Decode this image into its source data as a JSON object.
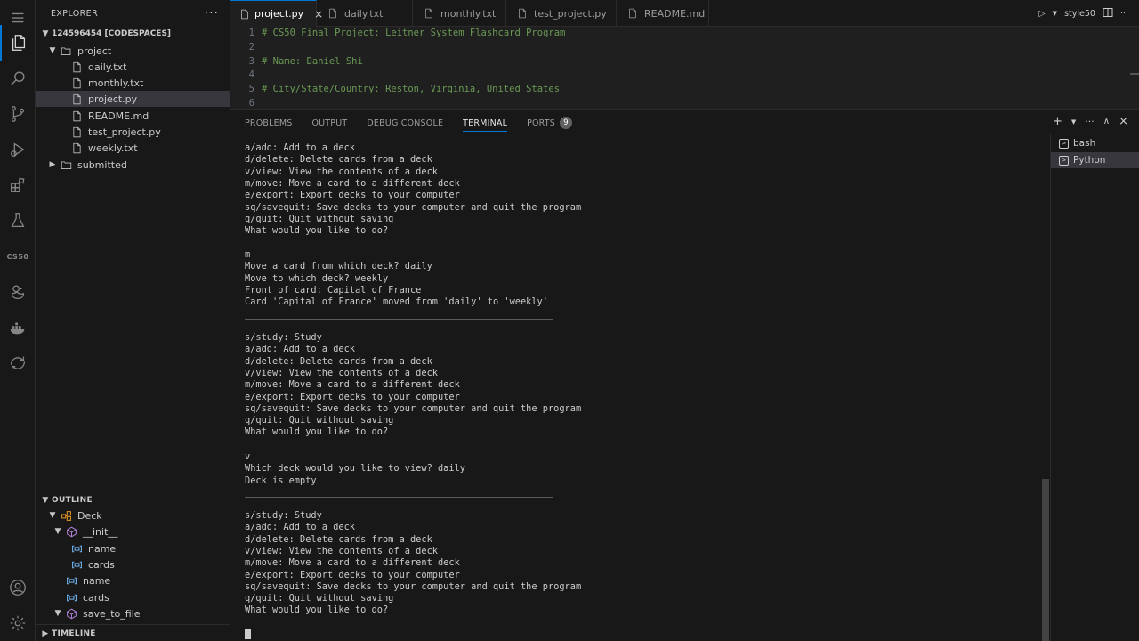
{
  "sidebar": {
    "title": "EXPLORER",
    "root": "124596454 [CODESPACES]",
    "items": [
      {
        "label": "project",
        "kind": "folder-open"
      },
      {
        "label": "daily.txt",
        "kind": "file"
      },
      {
        "label": "monthly.txt",
        "kind": "file"
      },
      {
        "label": "project.py",
        "kind": "file"
      },
      {
        "label": "README.md",
        "kind": "file"
      },
      {
        "label": "test_project.py",
        "kind": "file"
      },
      {
        "label": "weekly.txt",
        "kind": "file"
      },
      {
        "label": "submitted",
        "kind": "folder-closed"
      }
    ]
  },
  "outline": {
    "title": "OUTLINE",
    "items": [
      {
        "label": "Deck",
        "kind": "class"
      },
      {
        "label": "__init__",
        "kind": "method"
      },
      {
        "label": "name",
        "kind": "field"
      },
      {
        "label": "cards",
        "kind": "field"
      },
      {
        "label": "name",
        "kind": "field"
      },
      {
        "label": "cards",
        "kind": "field"
      },
      {
        "label": "save_to_file",
        "kind": "method"
      }
    ]
  },
  "timeline": {
    "title": "TIMELINE"
  },
  "activity": {
    "cs50_label": "CS50"
  },
  "tabs": [
    {
      "label": "project.py",
      "close": "×"
    },
    {
      "label": "daily.txt"
    },
    {
      "label": "monthly.txt"
    },
    {
      "label": "test_project.py"
    },
    {
      "label": "README.md"
    }
  ],
  "tab_actions": {
    "style50": "style50"
  },
  "editor": {
    "lines": [
      {
        "num": "1",
        "text": "# CS50 Final Project: Leitner System Flashcard Program"
      },
      {
        "num": "2",
        "text": ""
      },
      {
        "num": "3",
        "text": "# Name: Daniel Shi"
      },
      {
        "num": "4",
        "text": ""
      },
      {
        "num": "5",
        "text": "# City/State/Country: Reston, Virginia, United States"
      },
      {
        "num": "6",
        "text": ""
      }
    ]
  },
  "panel": {
    "tabs": [
      "PROBLEMS",
      "OUTPUT",
      "DEBUG CONSOLE",
      "TERMINAL",
      "PORTS"
    ],
    "ports_count": "9",
    "terminals": [
      "bash",
      "Python"
    ]
  },
  "terminal": {
    "block1": [
      "a/add: Add to a deck",
      "d/delete: Delete cards from a deck",
      "v/view: View the contents of a deck",
      "m/move: Move a card to a different deck",
      "e/export: Export decks to your computer",
      "sq/savequit: Save decks to your computer and quit the program",
      "q/quit: Quit without saving",
      "What would you like to do?"
    ],
    "block2": [
      "m",
      "Move a card from which deck? daily",
      "Move to which deck? weekly",
      "Front of card: Capital of France",
      "Card 'Capital of France' moved from 'daily' to 'weekly'"
    ],
    "block3": [
      "s/study: Study",
      "a/add: Add to a deck",
      "d/delete: Delete cards from a deck",
      "v/view: View the contents of a deck",
      "m/move: Move a card to a different deck",
      "e/export: Export decks to your computer",
      "sq/savequit: Save decks to your computer and quit the program",
      "q/quit: Quit without saving",
      "What would you like to do?"
    ],
    "block4": [
      "v",
      "Which deck would you like to view? daily",
      "Deck is empty"
    ],
    "block5": [
      "s/study: Study",
      "a/add: Add to a deck",
      "d/delete: Delete cards from a deck",
      "v/view: View the contents of a deck",
      "m/move: Move a card to a different deck",
      "e/export: Export decks to your computer",
      "sq/savequit: Save decks to your computer and quit the program",
      "q/quit: Quit without saving",
      "What would you like to do?"
    ]
  }
}
